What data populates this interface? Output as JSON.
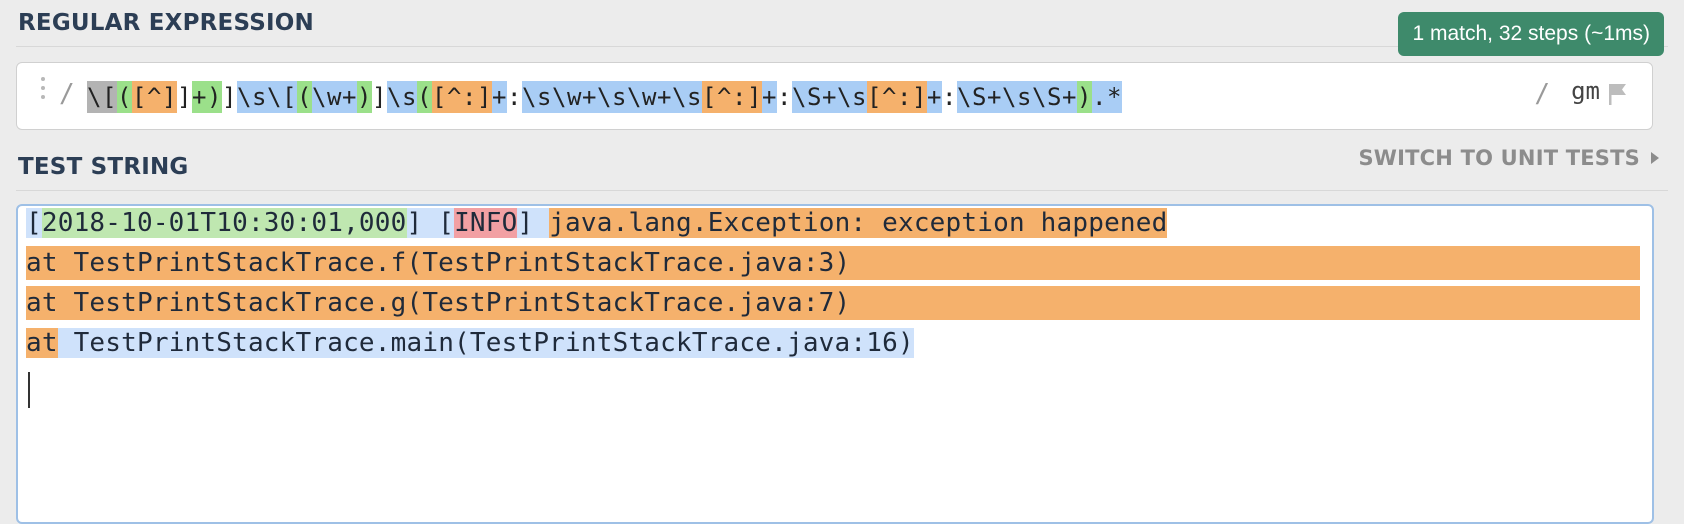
{
  "header": {
    "regex_title": "REGULAR EXPRESSION",
    "match_info": "1 match, 32 steps (~1ms)"
  },
  "regex": {
    "open_delimiter": "/",
    "close_delimiter": "/",
    "flags": "gm",
    "tokens": [
      {
        "text": "\\[",
        "color": "gray"
      },
      {
        "text": "(",
        "color": "green"
      },
      {
        "text": "[^]",
        "color": "orange"
      },
      {
        "text": "]",
        "color": "plain"
      },
      {
        "text": "+)",
        "color": "green"
      },
      {
        "text": "]",
        "color": "plain"
      },
      {
        "text": "\\s\\[",
        "color": "blue"
      },
      {
        "text": "(",
        "color": "green"
      },
      {
        "text": "\\w+",
        "color": "blue"
      },
      {
        "text": ")",
        "color": "green"
      },
      {
        "text": "]",
        "color": "plain"
      },
      {
        "text": "\\s",
        "color": "blue"
      },
      {
        "text": "(",
        "color": "green"
      },
      {
        "text": "[^:]",
        "color": "orange"
      },
      {
        "text": "+",
        "color": "blue"
      },
      {
        "text": ":",
        "color": "plain"
      },
      {
        "text": "\\s\\w+\\s\\w+\\s",
        "color": "blue"
      },
      {
        "text": "[^:]",
        "color": "orange"
      },
      {
        "text": "+",
        "color": "blue"
      },
      {
        "text": ":",
        "color": "plain"
      },
      {
        "text": "\\S+\\s",
        "color": "blue"
      },
      {
        "text": "[^:]",
        "color": "orange"
      },
      {
        "text": "+",
        "color": "blue"
      },
      {
        "text": ":",
        "color": "plain"
      },
      {
        "text": "\\S+\\s\\S+",
        "color": "blue"
      },
      {
        "text": ")",
        "color": "green"
      },
      {
        "text": ".*",
        "color": "blue"
      }
    ]
  },
  "test_section": {
    "title": "TEST STRING",
    "switch_label": "SWITCH TO UNIT TESTS"
  },
  "test_string": {
    "line1": {
      "p1": "[",
      "timestamp": "2018-10-01T10:30:01,000",
      "p2": "] [",
      "level": "INFO",
      "p3": "] ",
      "message": "java.lang.Exception: exception happened"
    },
    "line2": "at TestPrintStackTrace.f(TestPrintStackTrace.java:3)",
    "line3": "at TestPrintStackTrace.g(TestPrintStackTrace.java:7)",
    "line4": {
      "prefix": "at",
      "rest": " TestPrintStackTrace.main(TestPrintStackTrace.java:16)"
    }
  },
  "icons": {
    "drag": "drag-handle-icon",
    "flag": "flag-icon",
    "arrow": "chevron-right-icon"
  },
  "colors": {
    "badge": "#3e8a6b",
    "match_orange": "#f5b16c",
    "match_blue": "#cfe2fb",
    "group_green": "#bfe7b0",
    "group_red": "#f2a0a3"
  }
}
